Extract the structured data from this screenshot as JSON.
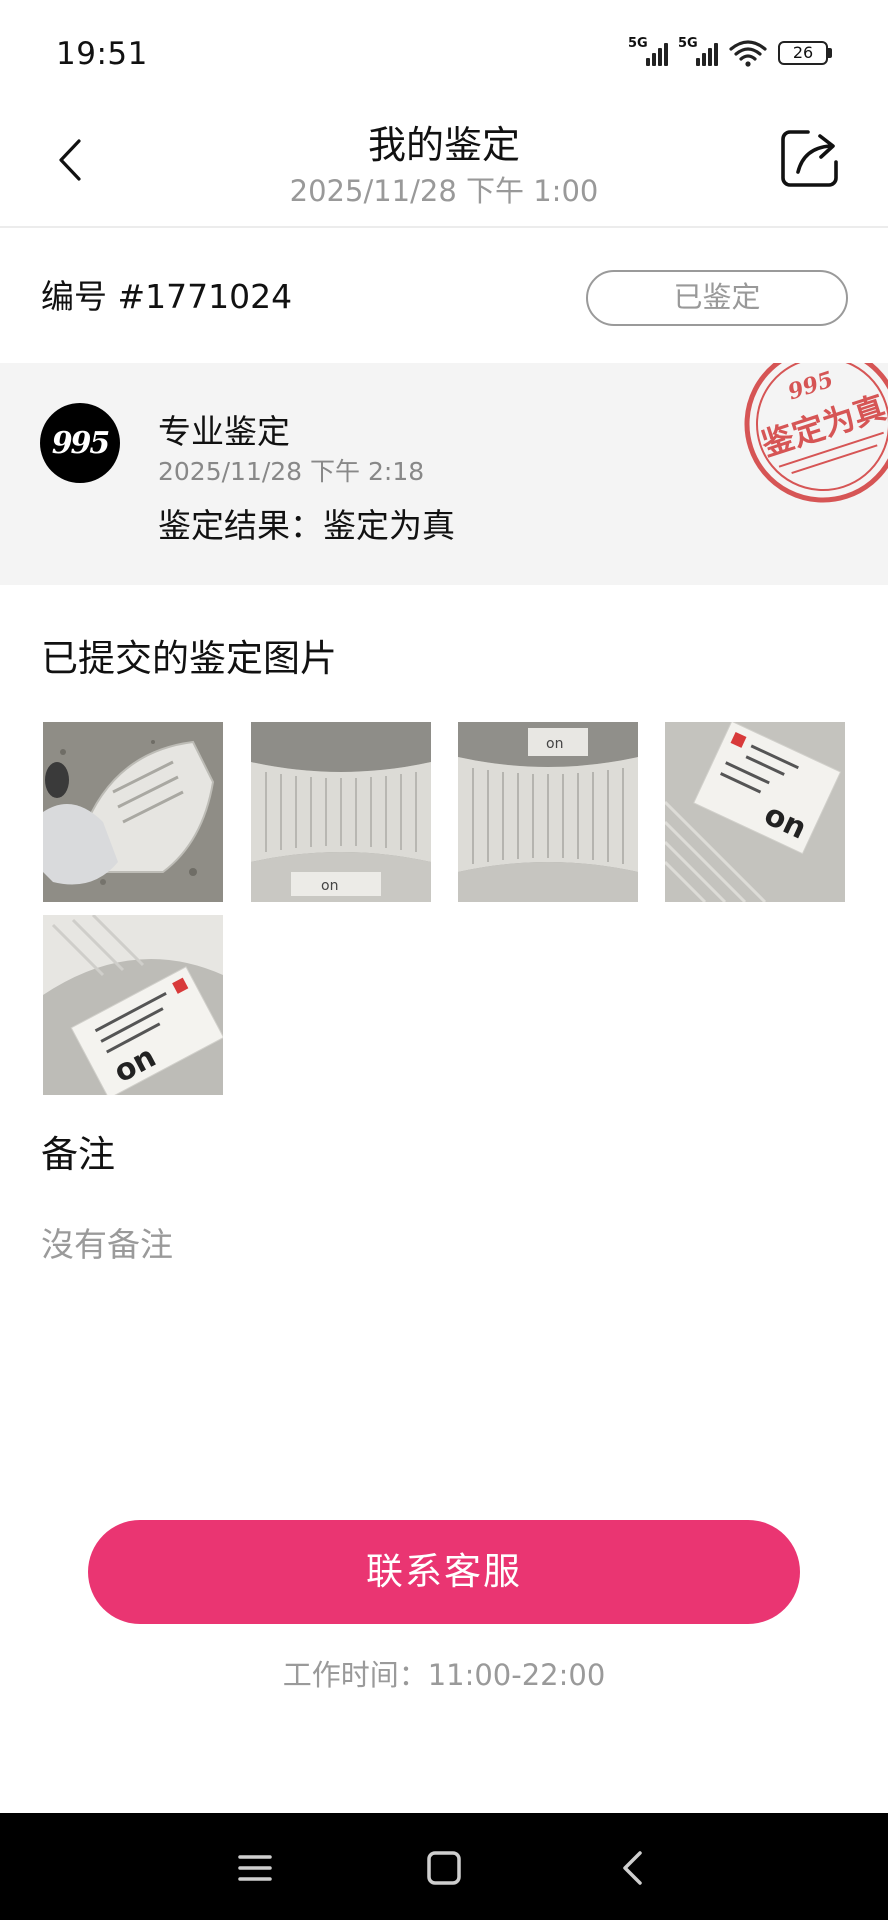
{
  "status_bar": {
    "time": "19:51",
    "signal1_tag": "5G",
    "signal2_tag": "5G",
    "battery": "26",
    "icons": [
      "signal-icon",
      "signal-icon",
      "wifi-icon",
      "battery-icon"
    ]
  },
  "header": {
    "title": "我的鉴定",
    "subtitle": "2025/11/28 下午 1:00",
    "back_icon": "chevron-left-icon",
    "share_icon": "share-icon"
  },
  "order": {
    "id_label": "编号 #1771024",
    "status": "已鉴定"
  },
  "result": {
    "logo_text": "995",
    "title": "专业鉴定",
    "time": "2025/11/28 下午 2:18",
    "result_text": "鉴定结果：鉴定为真",
    "stamp_text": "鉴定为真",
    "stamp_logo": "995",
    "stamp_color": "#d13a3a"
  },
  "images_section": {
    "title": "已提交的鉴定图片",
    "count": 5
  },
  "notes": {
    "title": "备注",
    "empty_text": "沒有备注"
  },
  "contact": {
    "button_label": "联系客服",
    "hours": "工作时间：11:00-22:00",
    "accent": "#ea3572"
  },
  "nav_bar": {
    "icons": [
      "menu-icon",
      "home-icon",
      "back-icon"
    ]
  }
}
